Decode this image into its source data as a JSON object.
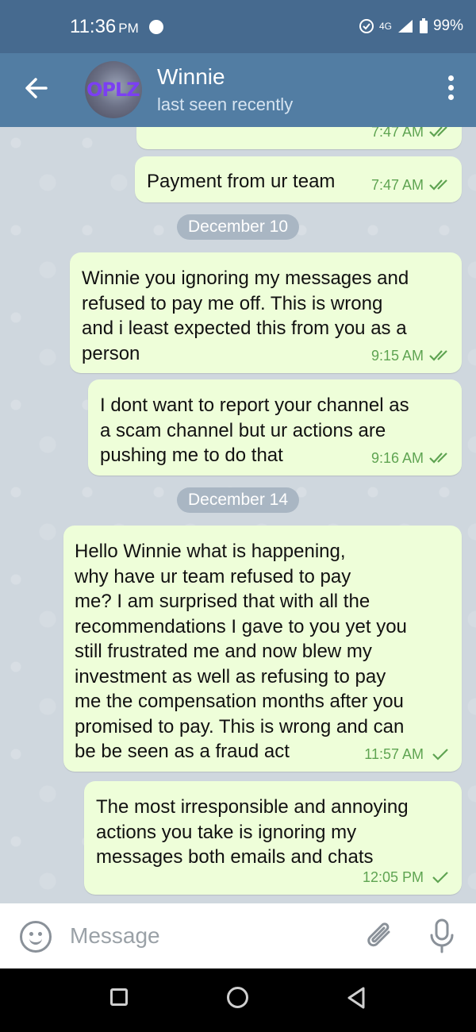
{
  "status_bar": {
    "time": "11:36",
    "ampm": "PM",
    "network": "4G",
    "battery": "99%"
  },
  "header": {
    "contact_name": "Winnie",
    "last_seen": "last seen recently",
    "avatar_text": "OPLZ"
  },
  "messages": [
    {
      "text": "",
      "time": "7:47 AM",
      "status": "read"
    },
    {
      "text": "Payment from ur team",
      "time": "7:47 AM",
      "status": "read"
    },
    {
      "date_divider": "December 10"
    },
    {
      "text": "Winnie you ignoring my messages and\nrefused to pay me off. This is wrong\nand i least expected this from you as a\nperson",
      "time": "9:15 AM",
      "status": "read"
    },
    {
      "text": "I dont want to report your channel as\na scam channel but ur actions are\npushing me to do that",
      "time": "9:16 AM",
      "status": "read"
    },
    {
      "date_divider": "December 14"
    },
    {
      "text": "Hello Winnie what is happening,\nwhy have ur team refused to pay\nme? I am surprised that with all the\nrecommendations I gave to you yet you\nstill frustrated me and now blew my\ninvestment as well as refusing to pay\nme the compensation months after you\npromised to pay. This is wrong and can\nbe be seen as a fraud act",
      "time": "11:57 AM",
      "status": "sent"
    },
    {
      "text": "The most irresponsible and annoying\nactions you take is ignoring my\nmessages both emails and chats",
      "time": "12:05 PM",
      "status": "sent"
    }
  ],
  "input": {
    "placeholder": "Message"
  },
  "colors": {
    "header": "#527da3",
    "status_bar": "#466a8f",
    "bubble_out": "#eefed9",
    "check": "#5fa452",
    "chat_bg": "#cfd7de"
  }
}
